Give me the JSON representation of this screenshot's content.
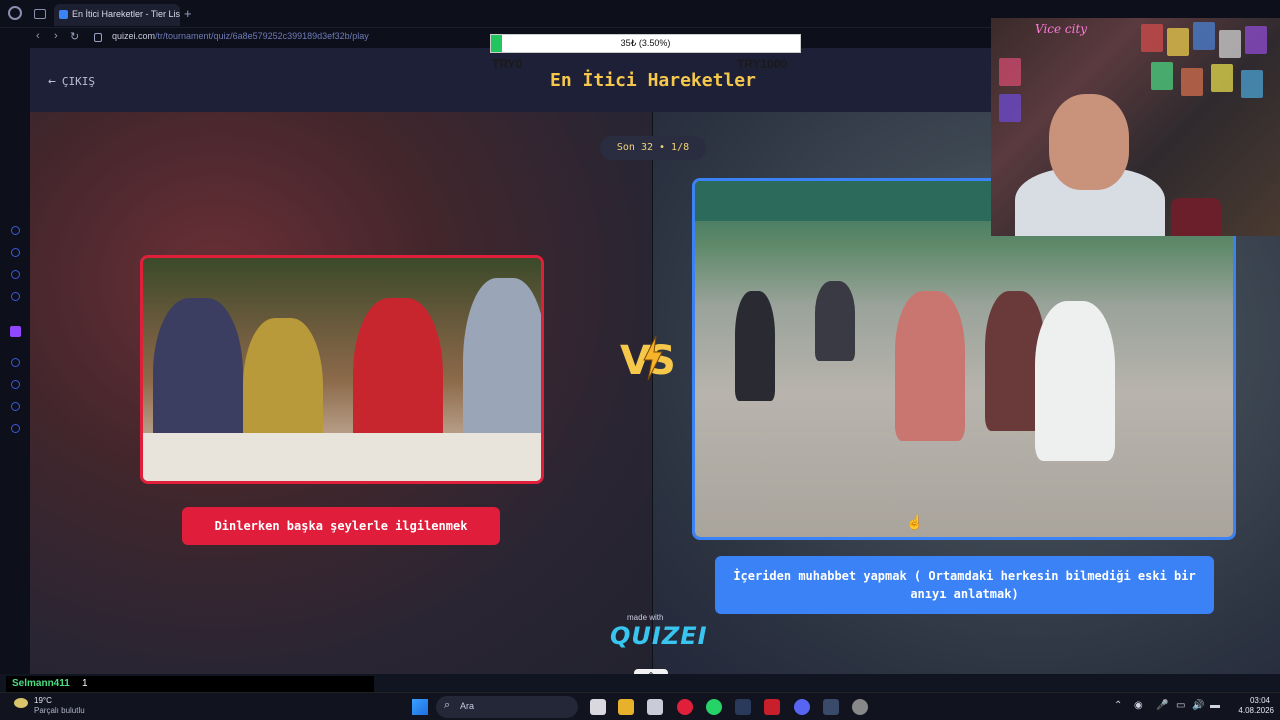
{
  "browser": {
    "tab_title": "En İtici Hareketler - Tier List",
    "tab_plus": "+",
    "url_host": "quizei.com",
    "url_path": "/tr/tournament/quiz/6a8e579252c399189d3ef32b/play",
    "nav_back": "‹",
    "nav_forward": "›",
    "nav_reload": "↻"
  },
  "page": {
    "back_label": "ÇIKIŞ",
    "back_arrow": "←",
    "title": "En İtici Hareketler",
    "round_label": "Son 32 • 1/8",
    "vs_text": "VS",
    "made_with": "made with",
    "brand": "QUIZEI",
    "scroll_up": "⌃"
  },
  "choices": [
    {
      "label": "Dinlerken başka şeylerle ilgilenmek",
      "accent": "#e01d3a"
    },
    {
      "label": "İçeriden muhabbet yapmak ( Ortamdaki herkesin bilmediği eski bir anıyı anlatmak)",
      "accent": "#3b82f6"
    }
  ],
  "donation": {
    "text": "35₺ (3.50%)",
    "progress_percent": 3.5,
    "min_label": "TRY0",
    "max_label": "TRY1000"
  },
  "webcam": {
    "neon": "Vice city"
  },
  "chat": {
    "user": "Selmann411",
    "message": "1"
  },
  "taskbar": {
    "weather_temp": "19°C",
    "weather_desc": "Parçalı bulutlu",
    "search_placeholder": "Ara",
    "tray_up": "⌃",
    "time": "03:04",
    "date": "4.08.2026"
  },
  "colors": {
    "title_yellow": "#f5c84c",
    "left_red": "#e01d3a",
    "right_blue": "#3b82f6",
    "progress_green": "#22c55e"
  }
}
